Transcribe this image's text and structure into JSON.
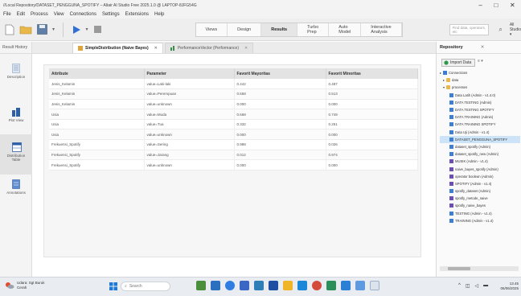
{
  "window": {
    "title": "//Local Repository/DATASET_PENGGUNA_SPOTIFY – Altair AI Studio Free 2025.1.0 @ LAPTOP-8JFG54G",
    "min": "–",
    "max": "□",
    "close": "✕"
  },
  "menu": [
    "File",
    "Edit",
    "Process",
    "View",
    "Connections",
    "Settings",
    "Extensions",
    "Help"
  ],
  "toolbar": {
    "views": [
      "Views",
      "Design",
      "Results",
      "Turbo Prep",
      "Auto Model",
      "Interactive Analysis"
    ],
    "active_view": "Results",
    "search_placeholder": "Find data, operators, etc",
    "studio_selector": "All Studio ▾"
  },
  "results_panel": {
    "header": "Result History",
    "side_items": [
      "Description",
      "Plot View",
      "Distribution Table",
      "Annotations"
    ],
    "active_item": "Distribution Table"
  },
  "tabs": [
    {
      "label": "SimpleDistribution (Naive Bayes)",
      "active": true,
      "close": "✕"
    },
    {
      "label": "PerformanceVector (Performance)",
      "active": false,
      "close": "✕"
    }
  ],
  "table": {
    "columns": [
      "Attribute",
      "Parameter",
      "Favorit Mayoritas",
      "Favorit Minoritas"
    ],
    "rows": [
      [
        "Jenis_Kelamin",
        "value=Laki-laki",
        "0.442",
        "0.487"
      ],
      [
        "Jenis_Kelamin",
        "value=Perempuan",
        "0.558",
        "0.513"
      ],
      [
        "Jenis_Kelamin",
        "value=unknown",
        "0.000",
        "0.000"
      ],
      [
        "Usia",
        "value=Muda",
        "0.668",
        "0.749"
      ],
      [
        "Usia",
        "value=Tua",
        "0.332",
        "0.251"
      ],
      [
        "Usia",
        "value=unknown",
        "0.000",
        "0.000"
      ],
      [
        "Frekuensi_Spotify",
        "value=Sering",
        "0.988",
        "0.026"
      ],
      [
        "Frekuensi_Spotify",
        "value=Jarang",
        "0.012",
        "0.974"
      ],
      [
        "Frekuensi_Spotify",
        "value=unknown",
        "0.000",
        "0.000"
      ]
    ]
  },
  "repository": {
    "title": "Repository",
    "close": "✕",
    "import_label": "Import Data",
    "more": "≡ ▾",
    "items": [
      {
        "label": "Connections",
        "level": 0,
        "toggle": "▸",
        "icon": "conn",
        "color": "#3a7bd5"
      },
      {
        "label": "data",
        "level": 1,
        "toggle": "▸",
        "icon": "folder",
        "color": "#e8b84a"
      },
      {
        "label": "processes",
        "level": 1,
        "toggle": "▾",
        "icon": "folder",
        "color": "#e8b84a"
      },
      {
        "label": "Data Latih (Admin - v1.4.0)",
        "level": 2,
        "toggle": "",
        "icon": "data",
        "color": "#3f7fd0"
      },
      {
        "label": "DATA TESTING (Admin)",
        "level": 2,
        "toggle": "",
        "icon": "data",
        "color": "#3f7fd0"
      },
      {
        "label": "DATA TESTING SPOTIFY",
        "level": 2,
        "toggle": "",
        "icon": "data",
        "color": "#3f7fd0"
      },
      {
        "label": "DATA TRAINING (Admin)",
        "level": 2,
        "toggle": "",
        "icon": "data",
        "color": "#3f7fd0"
      },
      {
        "label": "DATA TRAINING SPOTIFY",
        "level": 2,
        "toggle": "",
        "icon": "data",
        "color": "#3f7fd0"
      },
      {
        "label": "Data Uji (Admin - v1.4)",
        "level": 2,
        "toggle": "",
        "icon": "data",
        "color": "#3f7fd0"
      },
      {
        "label": "DATASET_PENGGUNA_SPOTIFY",
        "level": 2,
        "toggle": "",
        "icon": "process",
        "color": "#3f7fd0",
        "selected": true
      },
      {
        "label": "dataset_spotify (Admin)",
        "level": 2,
        "toggle": "",
        "icon": "data",
        "color": "#3f7fd0"
      },
      {
        "label": "dataset_spotify_new (Admin)",
        "level": 2,
        "toggle": "",
        "icon": "data",
        "color": "#3f7fd0"
      },
      {
        "label": "MUSIK (Admin - v1.4)",
        "level": 2,
        "toggle": "",
        "icon": "process",
        "color": "#6c4fb3"
      },
      {
        "label": "naive_bayes_spotify (Admin)",
        "level": 2,
        "toggle": "",
        "icon": "process",
        "color": "#6c4fb3"
      },
      {
        "label": "operator boolean (Admin)",
        "level": 2,
        "toggle": "",
        "icon": "process",
        "color": "#6c4fb3"
      },
      {
        "label": "SPOTIFY (Admin - v1.4)",
        "level": 2,
        "toggle": "",
        "icon": "process",
        "color": "#6c4fb3"
      },
      {
        "label": "spotify_dataset (Admin)",
        "level": 2,
        "toggle": "",
        "icon": "data",
        "color": "#3f7fd0"
      },
      {
        "label": "spotify_metode_naive",
        "level": 2,
        "toggle": "",
        "icon": "process",
        "color": "#6c4fb3"
      },
      {
        "label": "spotify_naive_bayes",
        "level": 2,
        "toggle": "",
        "icon": "process",
        "color": "#6c4fb3"
      },
      {
        "label": "TESTING (Admin - v1.4)",
        "level": 2,
        "toggle": "",
        "icon": "data",
        "color": "#3f7fd0"
      },
      {
        "label": "TRAINING (Admin - v1.4)",
        "level": 2,
        "toggle": "",
        "icon": "data",
        "color": "#3f7fd0"
      }
    ]
  },
  "taskbar": {
    "weather_line1": "Udara: Sgt Buruk",
    "weather_line2": "Cerah",
    "search": "Search",
    "time": "13.45",
    "date": "06/06/2025"
  },
  "colors": {
    "accent": "#3f7fd0",
    "selected_row": "#cde3f7",
    "toolbar_bg": "#eeeeee"
  }
}
